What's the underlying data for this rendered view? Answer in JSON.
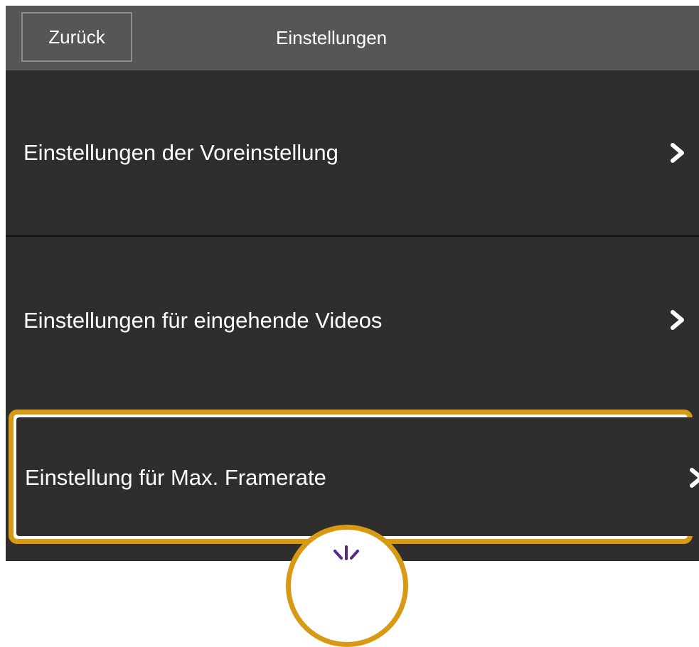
{
  "navbar": {
    "back_label": "Zurück",
    "title": "Einstellungen"
  },
  "rows": [
    {
      "label": "Einstellungen der Voreinstellung",
      "icon": "chevron-right-icon"
    },
    {
      "label": "Einstellungen für eingehende Videos",
      "icon": "chevron-right-icon"
    },
    {
      "label": "Einstellung für Max. Framerate",
      "icon": "chevron-right-icon",
      "highlighted": true
    }
  ],
  "annotation": {
    "icon": "tap-icon",
    "highlight_color": "#d89a14",
    "tap_icon_color": "#5b2a86"
  },
  "colors": {
    "navbar_background": "#575655",
    "list_background": "#2f2e2d",
    "text": "#ffffff"
  }
}
